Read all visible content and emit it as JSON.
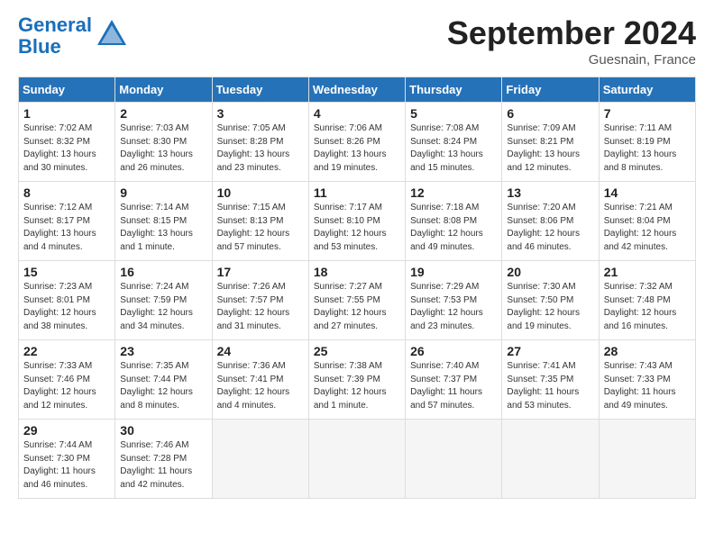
{
  "header": {
    "logo_line1": "General",
    "logo_line2": "Blue",
    "month_title": "September 2024",
    "location": "Guesnain, France"
  },
  "weekdays": [
    "Sunday",
    "Monday",
    "Tuesday",
    "Wednesday",
    "Thursday",
    "Friday",
    "Saturday"
  ],
  "weeks": [
    [
      {
        "day": "1",
        "info": "Sunrise: 7:02 AM\nSunset: 8:32 PM\nDaylight: 13 hours\nand 30 minutes."
      },
      {
        "day": "2",
        "info": "Sunrise: 7:03 AM\nSunset: 8:30 PM\nDaylight: 13 hours\nand 26 minutes."
      },
      {
        "day": "3",
        "info": "Sunrise: 7:05 AM\nSunset: 8:28 PM\nDaylight: 13 hours\nand 23 minutes."
      },
      {
        "day": "4",
        "info": "Sunrise: 7:06 AM\nSunset: 8:26 PM\nDaylight: 13 hours\nand 19 minutes."
      },
      {
        "day": "5",
        "info": "Sunrise: 7:08 AM\nSunset: 8:24 PM\nDaylight: 13 hours\nand 15 minutes."
      },
      {
        "day": "6",
        "info": "Sunrise: 7:09 AM\nSunset: 8:21 PM\nDaylight: 13 hours\nand 12 minutes."
      },
      {
        "day": "7",
        "info": "Sunrise: 7:11 AM\nSunset: 8:19 PM\nDaylight: 13 hours\nand 8 minutes."
      }
    ],
    [
      {
        "day": "8",
        "info": "Sunrise: 7:12 AM\nSunset: 8:17 PM\nDaylight: 13 hours\nand 4 minutes."
      },
      {
        "day": "9",
        "info": "Sunrise: 7:14 AM\nSunset: 8:15 PM\nDaylight: 13 hours\nand 1 minute."
      },
      {
        "day": "10",
        "info": "Sunrise: 7:15 AM\nSunset: 8:13 PM\nDaylight: 12 hours\nand 57 minutes."
      },
      {
        "day": "11",
        "info": "Sunrise: 7:17 AM\nSunset: 8:10 PM\nDaylight: 12 hours\nand 53 minutes."
      },
      {
        "day": "12",
        "info": "Sunrise: 7:18 AM\nSunset: 8:08 PM\nDaylight: 12 hours\nand 49 minutes."
      },
      {
        "day": "13",
        "info": "Sunrise: 7:20 AM\nSunset: 8:06 PM\nDaylight: 12 hours\nand 46 minutes."
      },
      {
        "day": "14",
        "info": "Sunrise: 7:21 AM\nSunset: 8:04 PM\nDaylight: 12 hours\nand 42 minutes."
      }
    ],
    [
      {
        "day": "15",
        "info": "Sunrise: 7:23 AM\nSunset: 8:01 PM\nDaylight: 12 hours\nand 38 minutes."
      },
      {
        "day": "16",
        "info": "Sunrise: 7:24 AM\nSunset: 7:59 PM\nDaylight: 12 hours\nand 34 minutes."
      },
      {
        "day": "17",
        "info": "Sunrise: 7:26 AM\nSunset: 7:57 PM\nDaylight: 12 hours\nand 31 minutes."
      },
      {
        "day": "18",
        "info": "Sunrise: 7:27 AM\nSunset: 7:55 PM\nDaylight: 12 hours\nand 27 minutes."
      },
      {
        "day": "19",
        "info": "Sunrise: 7:29 AM\nSunset: 7:53 PM\nDaylight: 12 hours\nand 23 minutes."
      },
      {
        "day": "20",
        "info": "Sunrise: 7:30 AM\nSunset: 7:50 PM\nDaylight: 12 hours\nand 19 minutes."
      },
      {
        "day": "21",
        "info": "Sunrise: 7:32 AM\nSunset: 7:48 PM\nDaylight: 12 hours\nand 16 minutes."
      }
    ],
    [
      {
        "day": "22",
        "info": "Sunrise: 7:33 AM\nSunset: 7:46 PM\nDaylight: 12 hours\nand 12 minutes."
      },
      {
        "day": "23",
        "info": "Sunrise: 7:35 AM\nSunset: 7:44 PM\nDaylight: 12 hours\nand 8 minutes."
      },
      {
        "day": "24",
        "info": "Sunrise: 7:36 AM\nSunset: 7:41 PM\nDaylight: 12 hours\nand 4 minutes."
      },
      {
        "day": "25",
        "info": "Sunrise: 7:38 AM\nSunset: 7:39 PM\nDaylight: 12 hours\nand 1 minute."
      },
      {
        "day": "26",
        "info": "Sunrise: 7:40 AM\nSunset: 7:37 PM\nDaylight: 11 hours\nand 57 minutes."
      },
      {
        "day": "27",
        "info": "Sunrise: 7:41 AM\nSunset: 7:35 PM\nDaylight: 11 hours\nand 53 minutes."
      },
      {
        "day": "28",
        "info": "Sunrise: 7:43 AM\nSunset: 7:33 PM\nDaylight: 11 hours\nand 49 minutes."
      }
    ],
    [
      {
        "day": "29",
        "info": "Sunrise: 7:44 AM\nSunset: 7:30 PM\nDaylight: 11 hours\nand 46 minutes."
      },
      {
        "day": "30",
        "info": "Sunrise: 7:46 AM\nSunset: 7:28 PM\nDaylight: 11 hours\nand 42 minutes."
      },
      {
        "day": "",
        "info": ""
      },
      {
        "day": "",
        "info": ""
      },
      {
        "day": "",
        "info": ""
      },
      {
        "day": "",
        "info": ""
      },
      {
        "day": "",
        "info": ""
      }
    ]
  ]
}
